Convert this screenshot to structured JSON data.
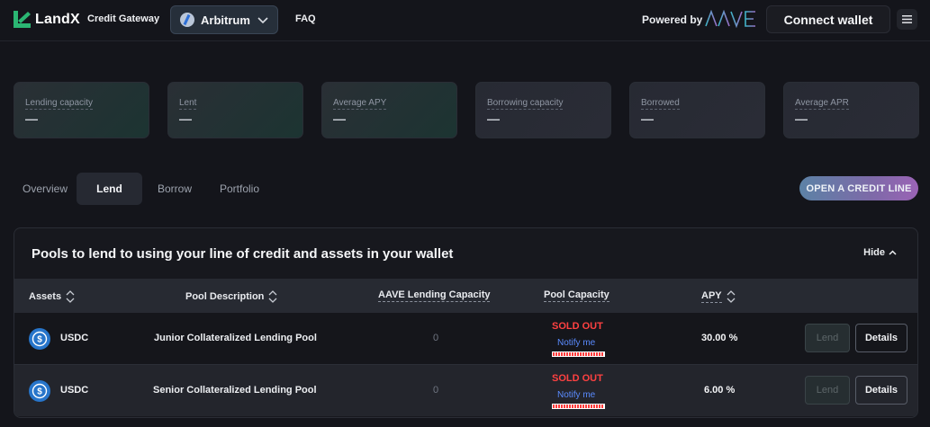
{
  "header": {
    "brand": "LandX",
    "subtitle": "Credit Gateway",
    "network": "Arbitrum",
    "faq": "FAQ",
    "powered_by": "Powered by",
    "aave_logo_text": "AAVE",
    "connect_wallet": "Connect wallet"
  },
  "stats": [
    {
      "label": "Lending capacity",
      "value": "—"
    },
    {
      "label": "Lent",
      "value": "—"
    },
    {
      "label": "Average APY",
      "value": "—"
    },
    {
      "label": "Borrowing capacity",
      "value": "—"
    },
    {
      "label": "Borrowed",
      "value": "—"
    },
    {
      "label": "Average APR",
      "value": "—"
    }
  ],
  "tabs": [
    {
      "label": "Overview",
      "active": false
    },
    {
      "label": "Lend",
      "active": true
    },
    {
      "label": "Borrow",
      "active": false
    },
    {
      "label": "Portfolio",
      "active": false
    }
  ],
  "open_credit_line": "OPEN A CREDIT LINE",
  "pools": {
    "title": "Pools to lend to using your line of credit and assets in your wallet",
    "hide_label": "Hide",
    "columns": {
      "assets": "Assets",
      "pool_description": "Pool Description",
      "aave_capacity": "AAVE Lending Capacity",
      "pool_capacity": "Pool Capacity",
      "apy": "APY"
    },
    "rows": [
      {
        "asset": "USDC",
        "description": "Junior Collateralized Lending Pool",
        "aave_capacity": "0",
        "status": "SOLD OUT",
        "notify": "Notify me",
        "apy": "30.00 %",
        "lend": "Lend",
        "details": "Details"
      },
      {
        "asset": "USDC",
        "description": "Senior Collateralized Lending Pool",
        "aave_capacity": "0",
        "status": "SOLD OUT",
        "notify": "Notify me",
        "apy": "6.00 %",
        "lend": "Lend",
        "details": "Details"
      }
    ]
  },
  "colors": {
    "background": "#14151b",
    "accent_green": "#2bb673",
    "sold_out_red": "#ff4141",
    "notify_blue": "#5a8bff"
  },
  "icons": [
    "landx-logo-icon",
    "arbitrum-icon",
    "chevron-down-icon",
    "aave-logo",
    "menu-icon",
    "sort-icon",
    "chevron-up-icon",
    "usdc-icon"
  ]
}
